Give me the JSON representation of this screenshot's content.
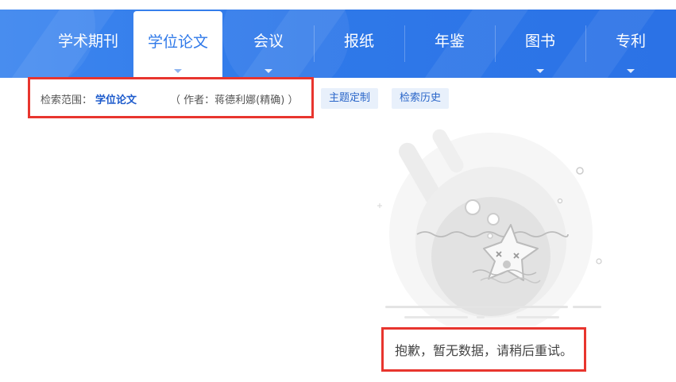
{
  "nav": {
    "tabs": [
      {
        "label": "学术期刊",
        "active": false
      },
      {
        "label": "学位论文",
        "active": true
      },
      {
        "label": "会议",
        "active": false
      },
      {
        "label": "报纸",
        "active": false
      },
      {
        "label": "年鉴",
        "active": false
      },
      {
        "label": "图书",
        "active": false
      },
      {
        "label": "专利",
        "active": false
      }
    ]
  },
  "search_scope": {
    "label": "检索范围：",
    "value": "学位论文",
    "condition": "（ 作者：蒋德利娜(精确) ）"
  },
  "actions": {
    "theme_custom": "主题定制",
    "search_history": "检索历史"
  },
  "empty_state": {
    "message": "抱歉，暂无数据，请稍后重试。"
  },
  "colors": {
    "nav_bg": "#2f79e9",
    "highlight_border": "#e8352e",
    "link": "#1d5bcc",
    "pill_bg": "#e8f0fb"
  }
}
